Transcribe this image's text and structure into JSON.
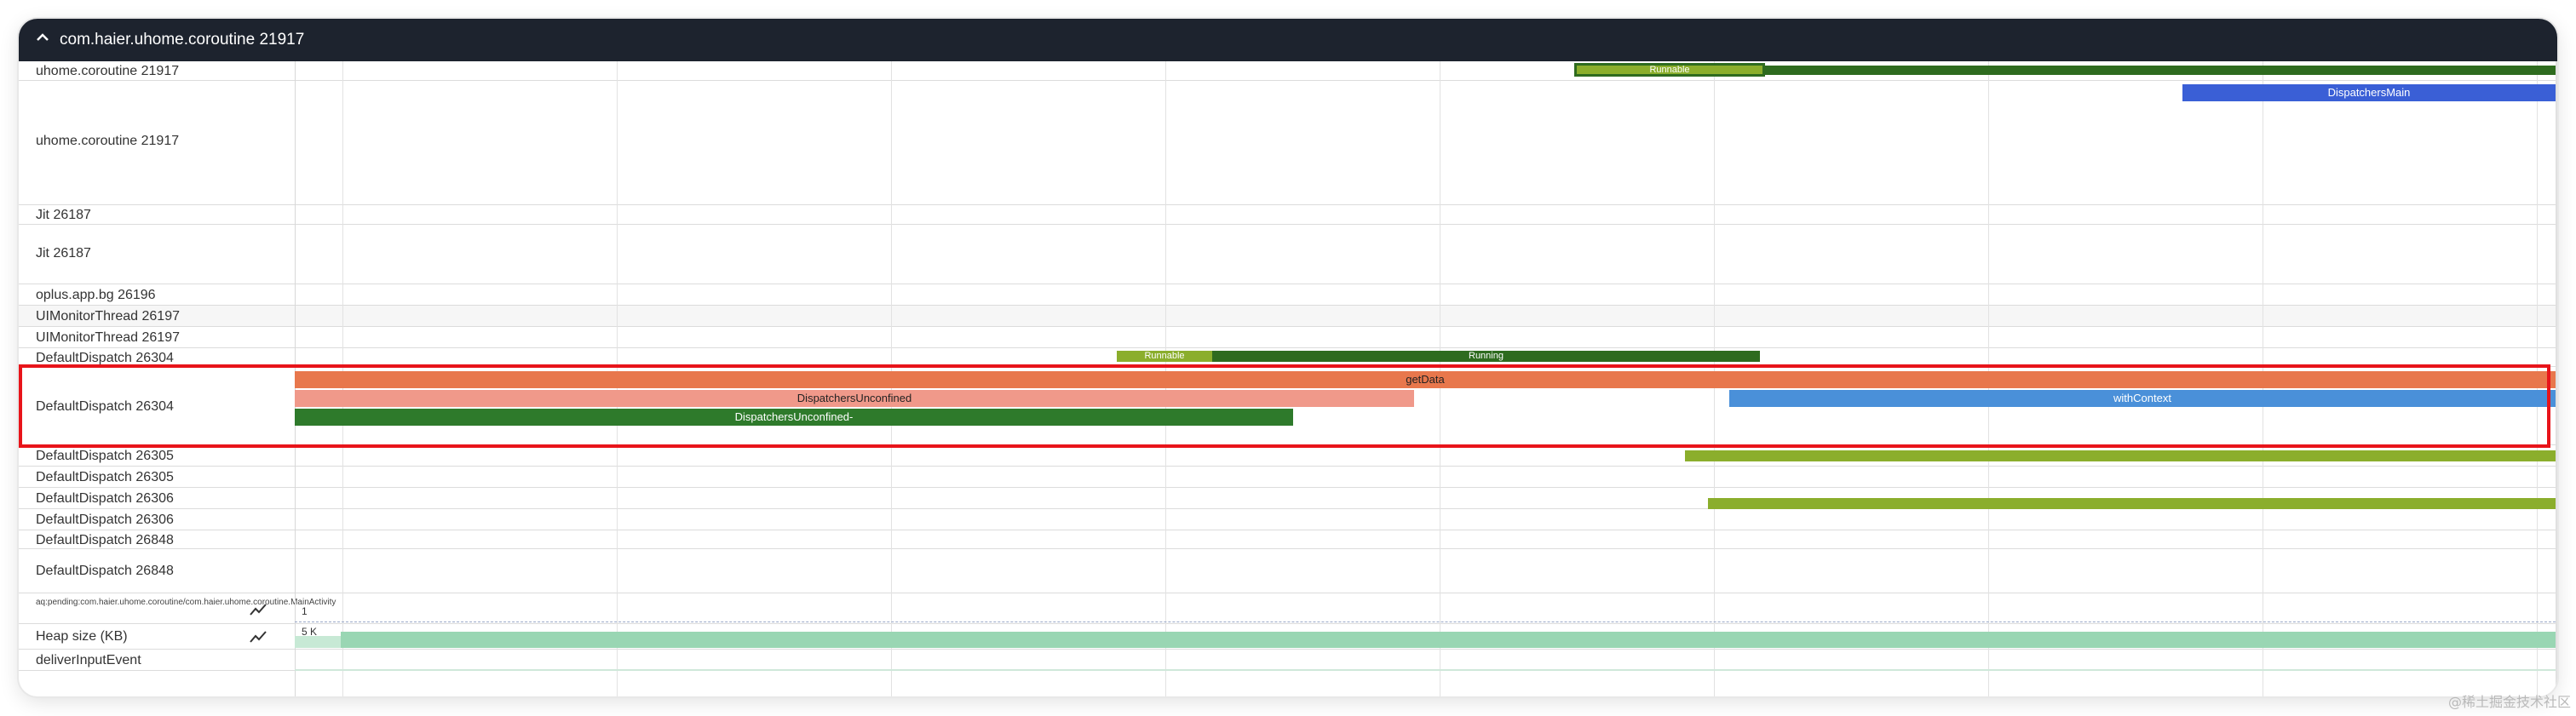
{
  "header": {
    "title": "com.haier.uhome.coroutine 21917"
  },
  "tracks": {
    "t0": "uhome.coroutine 21917",
    "t1": "uhome.coroutine 21917",
    "t2": "Jit 26187",
    "t3": "Jit 26187",
    "t4": "oplus.app.bg 26196",
    "t5": "UIMonitorThread 26197",
    "t6": "UIMonitorThread 26197",
    "t7": "DefaultDispatch 26304",
    "t8": "DefaultDispatch 26304",
    "t9": "DefaultDispatch 26305",
    "t10": "DefaultDispatch 26305",
    "t11": "DefaultDispatch 26306",
    "t12": "DefaultDispatch 26306",
    "t13": "DefaultDispatch 26848",
    "t14": "DefaultDispatch 26848",
    "t15": "aq:pending:com.haier.uhome.coroutine/com.haier.uhome.coroutine.MainActivity",
    "t16": "Heap size (KB)",
    "t17": "deliverInputEvent"
  },
  "slices": {
    "runnable1": "Runnable",
    "dispatchers_main": "DispatchersMain",
    "runnable2": "Runnable",
    "running": "Running",
    "get_data": "getData",
    "dispatchers_unconfined": "DispatchersUnconfined",
    "with_context": "withContext",
    "dispatchers_unconfined_dash": "DispatchersUnconfined-"
  },
  "counters": {
    "pending_value": "1",
    "heap_value": "5 K"
  },
  "colors": {
    "runnable": "#8bae2c",
    "running": "#2e6b1f",
    "get_data": "#e8774c",
    "dispatchers_unconfined": "#f0998a",
    "with_context": "#4a90d9",
    "dispatchers_main": "#3a5fd6",
    "heap": "#99d6b3",
    "highlight": "#e8141a"
  },
  "watermark": "@稀土掘金技术社区"
}
